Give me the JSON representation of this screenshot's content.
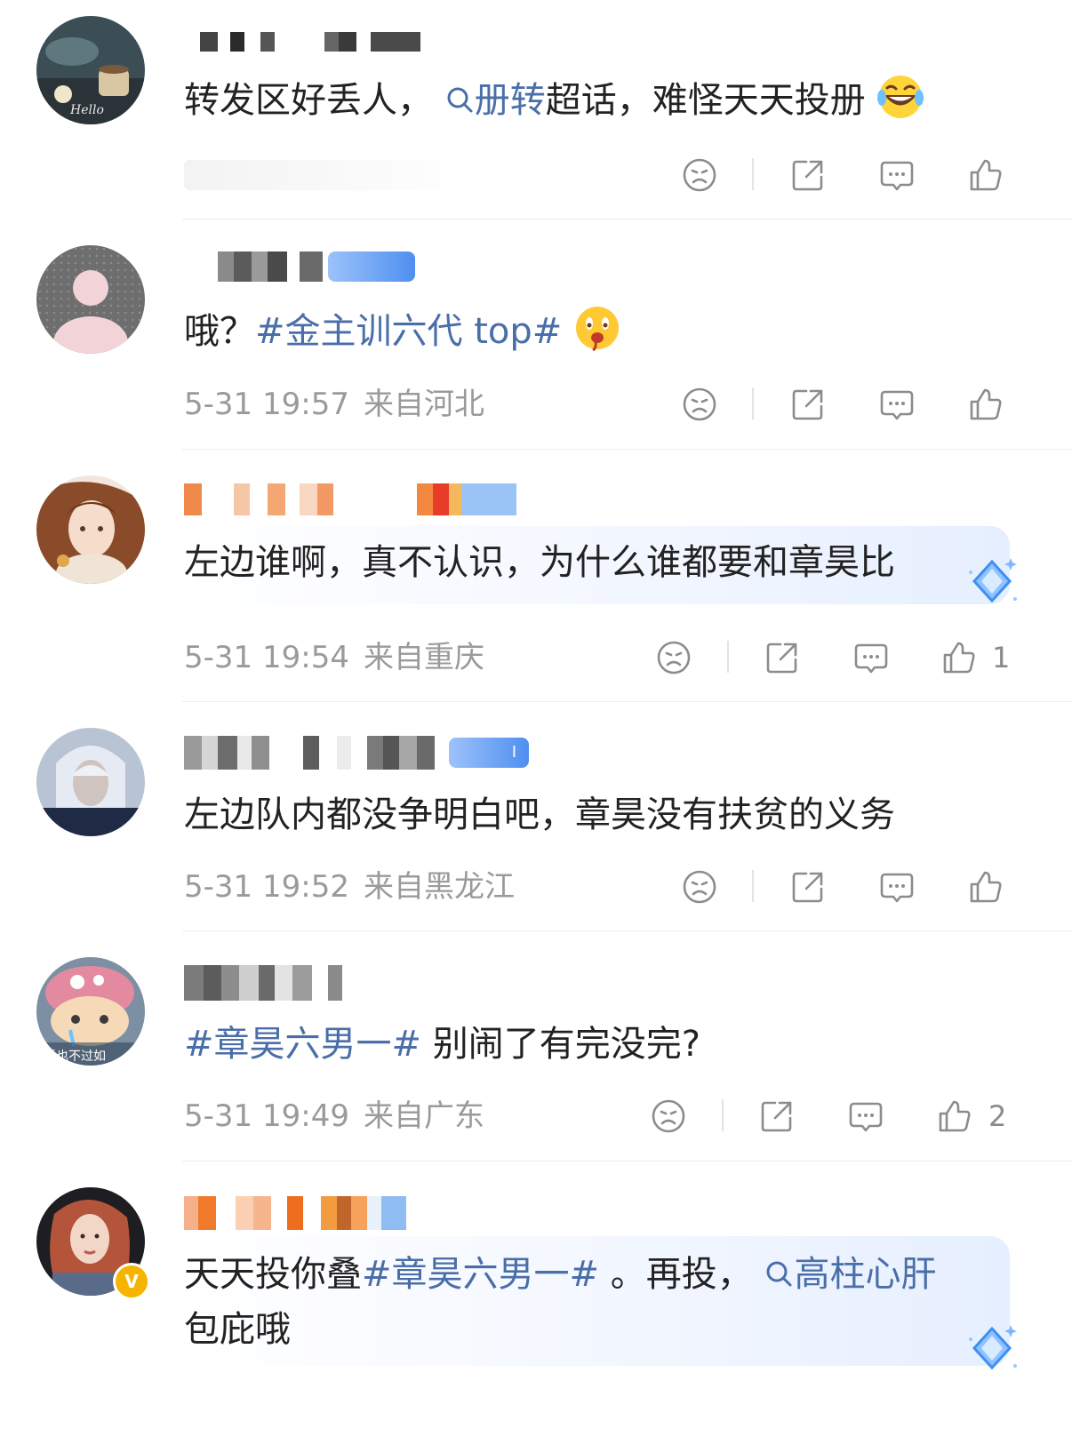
{
  "comments": [
    {
      "id": "c1",
      "text_parts": [
        "转发区好丢人，",
        "册转",
        "超话，难怪天天投册"
      ],
      "time": "",
      "region": "",
      "like_count": ""
    },
    {
      "id": "c2",
      "text_parts": [
        "哦？",
        "#金主训六代 top#"
      ],
      "time": "5-31 19:57",
      "region": "来自河北",
      "like_count": ""
    },
    {
      "id": "c3",
      "text_parts": [
        "左边谁啊，真不认识，为什么谁都要和章昊比"
      ],
      "time": "5-31 19:54",
      "region": "来自重庆",
      "like_count": "1"
    },
    {
      "id": "c4",
      "text_parts": [
        "左边队内都没争明白吧，章昊没有扶贫的义务"
      ],
      "badge": "Ⅰ",
      "time": "5-31 19:52",
      "region": "来自黑龙江",
      "like_count": ""
    },
    {
      "id": "c5",
      "text_parts": [
        "#章昊六男一#",
        " 别闹了有完没完?"
      ],
      "avatar_caption": "活也不过如",
      "time": "5-31 19:49",
      "region": "来自广东",
      "like_count": "2"
    },
    {
      "id": "c6",
      "text_parts": [
        "天天投你叠",
        "#章昊六男一#",
        " 。再投，",
        "高柱心肝",
        "包庇哦"
      ],
      "verified_mark": "V"
    }
  ],
  "icons": {
    "dislike": "frown-face-icon",
    "repost": "share-icon",
    "comment": "comment-bubble-icon",
    "like": "thumbs-up-icon",
    "search": "search-icon"
  },
  "colors": {
    "topic_link": "#4a6ea8",
    "meta_text": "#9a9a9a",
    "divider": "#ececec"
  }
}
